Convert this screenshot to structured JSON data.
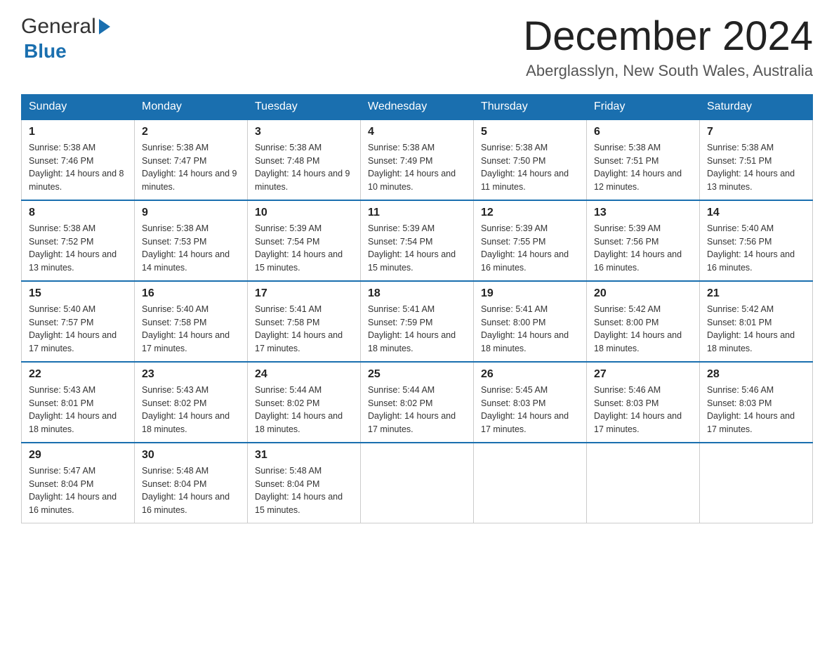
{
  "logo": {
    "general": "General",
    "blue": "Blue",
    "triangle": "▶"
  },
  "header": {
    "month_title": "December 2024",
    "location": "Aberglasslyn, New South Wales, Australia"
  },
  "days_of_week": [
    "Sunday",
    "Monday",
    "Tuesday",
    "Wednesday",
    "Thursday",
    "Friday",
    "Saturday"
  ],
  "weeks": [
    [
      {
        "day": "1",
        "sunrise": "Sunrise: 5:38 AM",
        "sunset": "Sunset: 7:46 PM",
        "daylight": "Daylight: 14 hours and 8 minutes."
      },
      {
        "day": "2",
        "sunrise": "Sunrise: 5:38 AM",
        "sunset": "Sunset: 7:47 PM",
        "daylight": "Daylight: 14 hours and 9 minutes."
      },
      {
        "day": "3",
        "sunrise": "Sunrise: 5:38 AM",
        "sunset": "Sunset: 7:48 PM",
        "daylight": "Daylight: 14 hours and 9 minutes."
      },
      {
        "day": "4",
        "sunrise": "Sunrise: 5:38 AM",
        "sunset": "Sunset: 7:49 PM",
        "daylight": "Daylight: 14 hours and 10 minutes."
      },
      {
        "day": "5",
        "sunrise": "Sunrise: 5:38 AM",
        "sunset": "Sunset: 7:50 PM",
        "daylight": "Daylight: 14 hours and 11 minutes."
      },
      {
        "day": "6",
        "sunrise": "Sunrise: 5:38 AM",
        "sunset": "Sunset: 7:51 PM",
        "daylight": "Daylight: 14 hours and 12 minutes."
      },
      {
        "day": "7",
        "sunrise": "Sunrise: 5:38 AM",
        "sunset": "Sunset: 7:51 PM",
        "daylight": "Daylight: 14 hours and 13 minutes."
      }
    ],
    [
      {
        "day": "8",
        "sunrise": "Sunrise: 5:38 AM",
        "sunset": "Sunset: 7:52 PM",
        "daylight": "Daylight: 14 hours and 13 minutes."
      },
      {
        "day": "9",
        "sunrise": "Sunrise: 5:38 AM",
        "sunset": "Sunset: 7:53 PM",
        "daylight": "Daylight: 14 hours and 14 minutes."
      },
      {
        "day": "10",
        "sunrise": "Sunrise: 5:39 AM",
        "sunset": "Sunset: 7:54 PM",
        "daylight": "Daylight: 14 hours and 15 minutes."
      },
      {
        "day": "11",
        "sunrise": "Sunrise: 5:39 AM",
        "sunset": "Sunset: 7:54 PM",
        "daylight": "Daylight: 14 hours and 15 minutes."
      },
      {
        "day": "12",
        "sunrise": "Sunrise: 5:39 AM",
        "sunset": "Sunset: 7:55 PM",
        "daylight": "Daylight: 14 hours and 16 minutes."
      },
      {
        "day": "13",
        "sunrise": "Sunrise: 5:39 AM",
        "sunset": "Sunset: 7:56 PM",
        "daylight": "Daylight: 14 hours and 16 minutes."
      },
      {
        "day": "14",
        "sunrise": "Sunrise: 5:40 AM",
        "sunset": "Sunset: 7:56 PM",
        "daylight": "Daylight: 14 hours and 16 minutes."
      }
    ],
    [
      {
        "day": "15",
        "sunrise": "Sunrise: 5:40 AM",
        "sunset": "Sunset: 7:57 PM",
        "daylight": "Daylight: 14 hours and 17 minutes."
      },
      {
        "day": "16",
        "sunrise": "Sunrise: 5:40 AM",
        "sunset": "Sunset: 7:58 PM",
        "daylight": "Daylight: 14 hours and 17 minutes."
      },
      {
        "day": "17",
        "sunrise": "Sunrise: 5:41 AM",
        "sunset": "Sunset: 7:58 PM",
        "daylight": "Daylight: 14 hours and 17 minutes."
      },
      {
        "day": "18",
        "sunrise": "Sunrise: 5:41 AM",
        "sunset": "Sunset: 7:59 PM",
        "daylight": "Daylight: 14 hours and 18 minutes."
      },
      {
        "day": "19",
        "sunrise": "Sunrise: 5:41 AM",
        "sunset": "Sunset: 8:00 PM",
        "daylight": "Daylight: 14 hours and 18 minutes."
      },
      {
        "day": "20",
        "sunrise": "Sunrise: 5:42 AM",
        "sunset": "Sunset: 8:00 PM",
        "daylight": "Daylight: 14 hours and 18 minutes."
      },
      {
        "day": "21",
        "sunrise": "Sunrise: 5:42 AM",
        "sunset": "Sunset: 8:01 PM",
        "daylight": "Daylight: 14 hours and 18 minutes."
      }
    ],
    [
      {
        "day": "22",
        "sunrise": "Sunrise: 5:43 AM",
        "sunset": "Sunset: 8:01 PM",
        "daylight": "Daylight: 14 hours and 18 minutes."
      },
      {
        "day": "23",
        "sunrise": "Sunrise: 5:43 AM",
        "sunset": "Sunset: 8:02 PM",
        "daylight": "Daylight: 14 hours and 18 minutes."
      },
      {
        "day": "24",
        "sunrise": "Sunrise: 5:44 AM",
        "sunset": "Sunset: 8:02 PM",
        "daylight": "Daylight: 14 hours and 18 minutes."
      },
      {
        "day": "25",
        "sunrise": "Sunrise: 5:44 AM",
        "sunset": "Sunset: 8:02 PM",
        "daylight": "Daylight: 14 hours and 17 minutes."
      },
      {
        "day": "26",
        "sunrise": "Sunrise: 5:45 AM",
        "sunset": "Sunset: 8:03 PM",
        "daylight": "Daylight: 14 hours and 17 minutes."
      },
      {
        "day": "27",
        "sunrise": "Sunrise: 5:46 AM",
        "sunset": "Sunset: 8:03 PM",
        "daylight": "Daylight: 14 hours and 17 minutes."
      },
      {
        "day": "28",
        "sunrise": "Sunrise: 5:46 AM",
        "sunset": "Sunset: 8:03 PM",
        "daylight": "Daylight: 14 hours and 17 minutes."
      }
    ],
    [
      {
        "day": "29",
        "sunrise": "Sunrise: 5:47 AM",
        "sunset": "Sunset: 8:04 PM",
        "daylight": "Daylight: 14 hours and 16 minutes."
      },
      {
        "day": "30",
        "sunrise": "Sunrise: 5:48 AM",
        "sunset": "Sunset: 8:04 PM",
        "daylight": "Daylight: 14 hours and 16 minutes."
      },
      {
        "day": "31",
        "sunrise": "Sunrise: 5:48 AM",
        "sunset": "Sunset: 8:04 PM",
        "daylight": "Daylight: 14 hours and 15 minutes."
      },
      null,
      null,
      null,
      null
    ]
  ]
}
